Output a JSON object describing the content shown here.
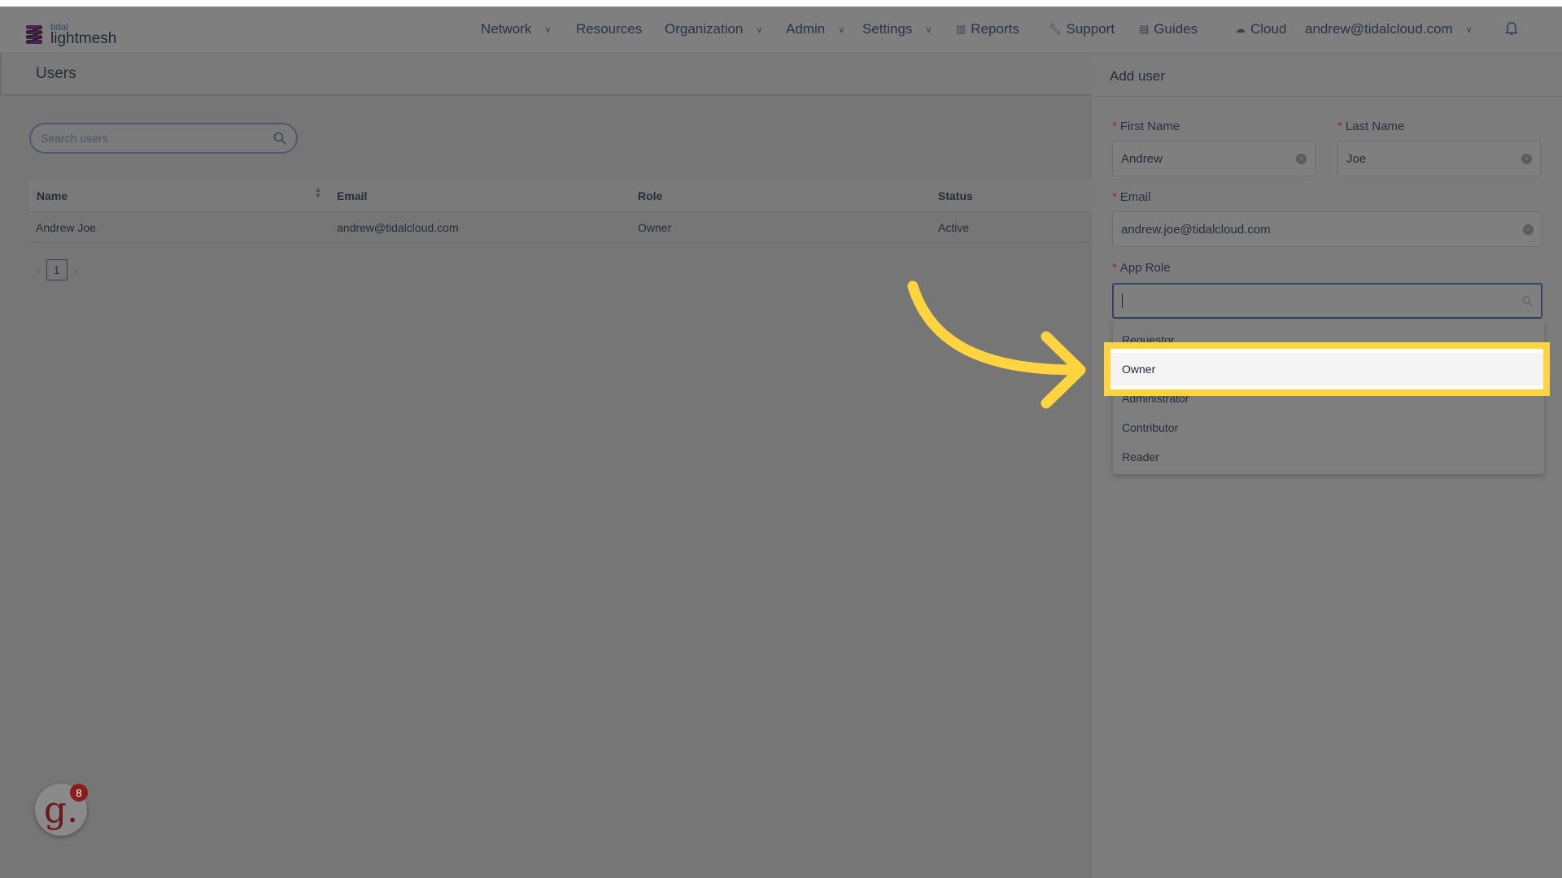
{
  "logo": {
    "top": "tidal",
    "bottom": "lightmesh"
  },
  "nav": {
    "network": "Network",
    "resources": "Resources",
    "organization": "Organization",
    "admin": "Admin",
    "settings": "Settings",
    "reports": "Reports",
    "support": "Support",
    "guides": "Guides",
    "cloud": "Cloud",
    "account": "andrew@tidalcloud.com"
  },
  "users": {
    "title": "Users",
    "search_placeholder": "Search users",
    "columns": [
      "Name",
      "Email",
      "Role",
      "Status"
    ],
    "rows": [
      {
        "name": "Andrew Joe",
        "email": "andrew@tidalcloud.com",
        "role": "Owner",
        "status": "Active"
      }
    ],
    "page": "1"
  },
  "add_user": {
    "title": "Add user",
    "first_name_label": "First Name",
    "first_name": "Andrew",
    "last_name_label": "Last Name",
    "last_name": "Joe",
    "email_label": "Email",
    "email": "andrew.joe@tidalcloud.com",
    "role_label": "App Role",
    "role_value": "",
    "role_options": [
      "Requestor",
      "Owner",
      "Administrator",
      "Contributor",
      "Reader"
    ],
    "highlighted_option": "Owner"
  },
  "widget": {
    "letter": "g.",
    "badge": "8"
  },
  "colors": {
    "highlight": "#ffd43f",
    "overlay": "#767676"
  }
}
